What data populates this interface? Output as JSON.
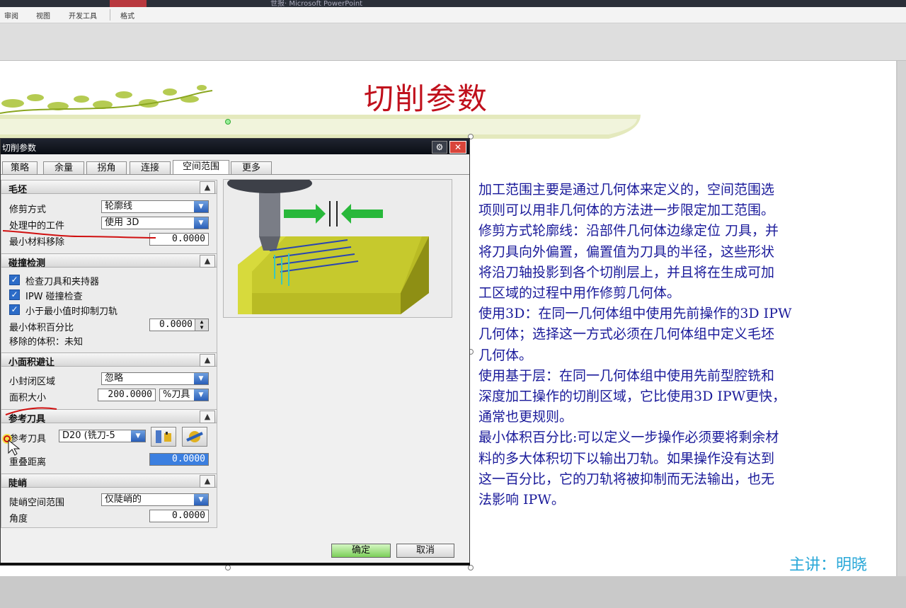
{
  "ribbon": {
    "window_title": "世报· Microsoft PowerPoint",
    "tabs": [
      "审阅",
      "视图",
      "开发工具",
      "格式"
    ]
  },
  "slide": {
    "title": "切削参数",
    "body_lines": [
      "加工范围主要是通过几何体来定义的，空间范围选",
      "项则可以用非几何体的方法进一步限定加工范围。",
      "修剪方式轮廓线：沿部件几何体边缘定位 刀具，并",
      "将刀具向外偏置，偏置值为刀具的半径，这些形状",
      "将沿刀轴投影到各个切削层上，并且将在生成可加",
      "工区域的过程中用作修剪几何体。",
      "使用3D：在同一几何体组中使用先前操作的3D IPW",
      "几何体；选择这一方式必须在几何体组中定义毛坯",
      "几何体。",
      "使用基于层：在同一几何体组中使用先前型腔铣和",
      "深度加工操作的切削区域，它比使用3D IPW更快，",
      "通常也更规则。",
      "最小体积百分比:可以定义一步操作必须要将剩余材",
      "料的多大体积切下以输出刀轨。如果操作没有达到",
      "这一百分比，它的刀轨将被抑制而无法输出，也无",
      "法影响 IPW。"
    ],
    "speaker": "主讲：明晓"
  },
  "dialog": {
    "title": "切削参数",
    "tabs": [
      "策略",
      "余量",
      "拐角",
      "连接",
      "空间范围",
      "更多"
    ],
    "active_tab": "空间范围",
    "blank": {
      "header": "毛坯",
      "trim_label": "修剪方式",
      "trim_value": "轮廓线",
      "ipw_label": "处理中的工件",
      "ipw_value": "使用 3D",
      "min_removal_label": "最小材料移除",
      "min_removal_value": "0.0000"
    },
    "collision": {
      "header": "碰撞检测",
      "check_holder": "检查刀具和夹持器",
      "ipw_check": "IPW 碰撞检查",
      "suppress": "小于最小值时抑制刀轨",
      "min_volume_label": "最小体积百分比",
      "min_volume_value": "0.0000",
      "removed_volume": "移除的体积：未知"
    },
    "small_area": {
      "header": "小面积避让",
      "closed_label": "小封闭区域",
      "closed_value": "忽略",
      "area_label": "面积大小",
      "area_value": "200.0000",
      "area_unit": "%刀具"
    },
    "ref_tool": {
      "header": "参考刀具",
      "tool_label": "参考刀具",
      "tool_value": "D20 (铣刀-5",
      "overlap_label": "重叠距离",
      "overlap_value": "0.0000"
    },
    "steep": {
      "header": "陡峭",
      "range_label": "陡峭空间范围",
      "range_value": "仅陡峭的",
      "angle_label": "角度",
      "angle_value": "0.0000"
    },
    "ok": "确定",
    "cancel": "取消"
  }
}
